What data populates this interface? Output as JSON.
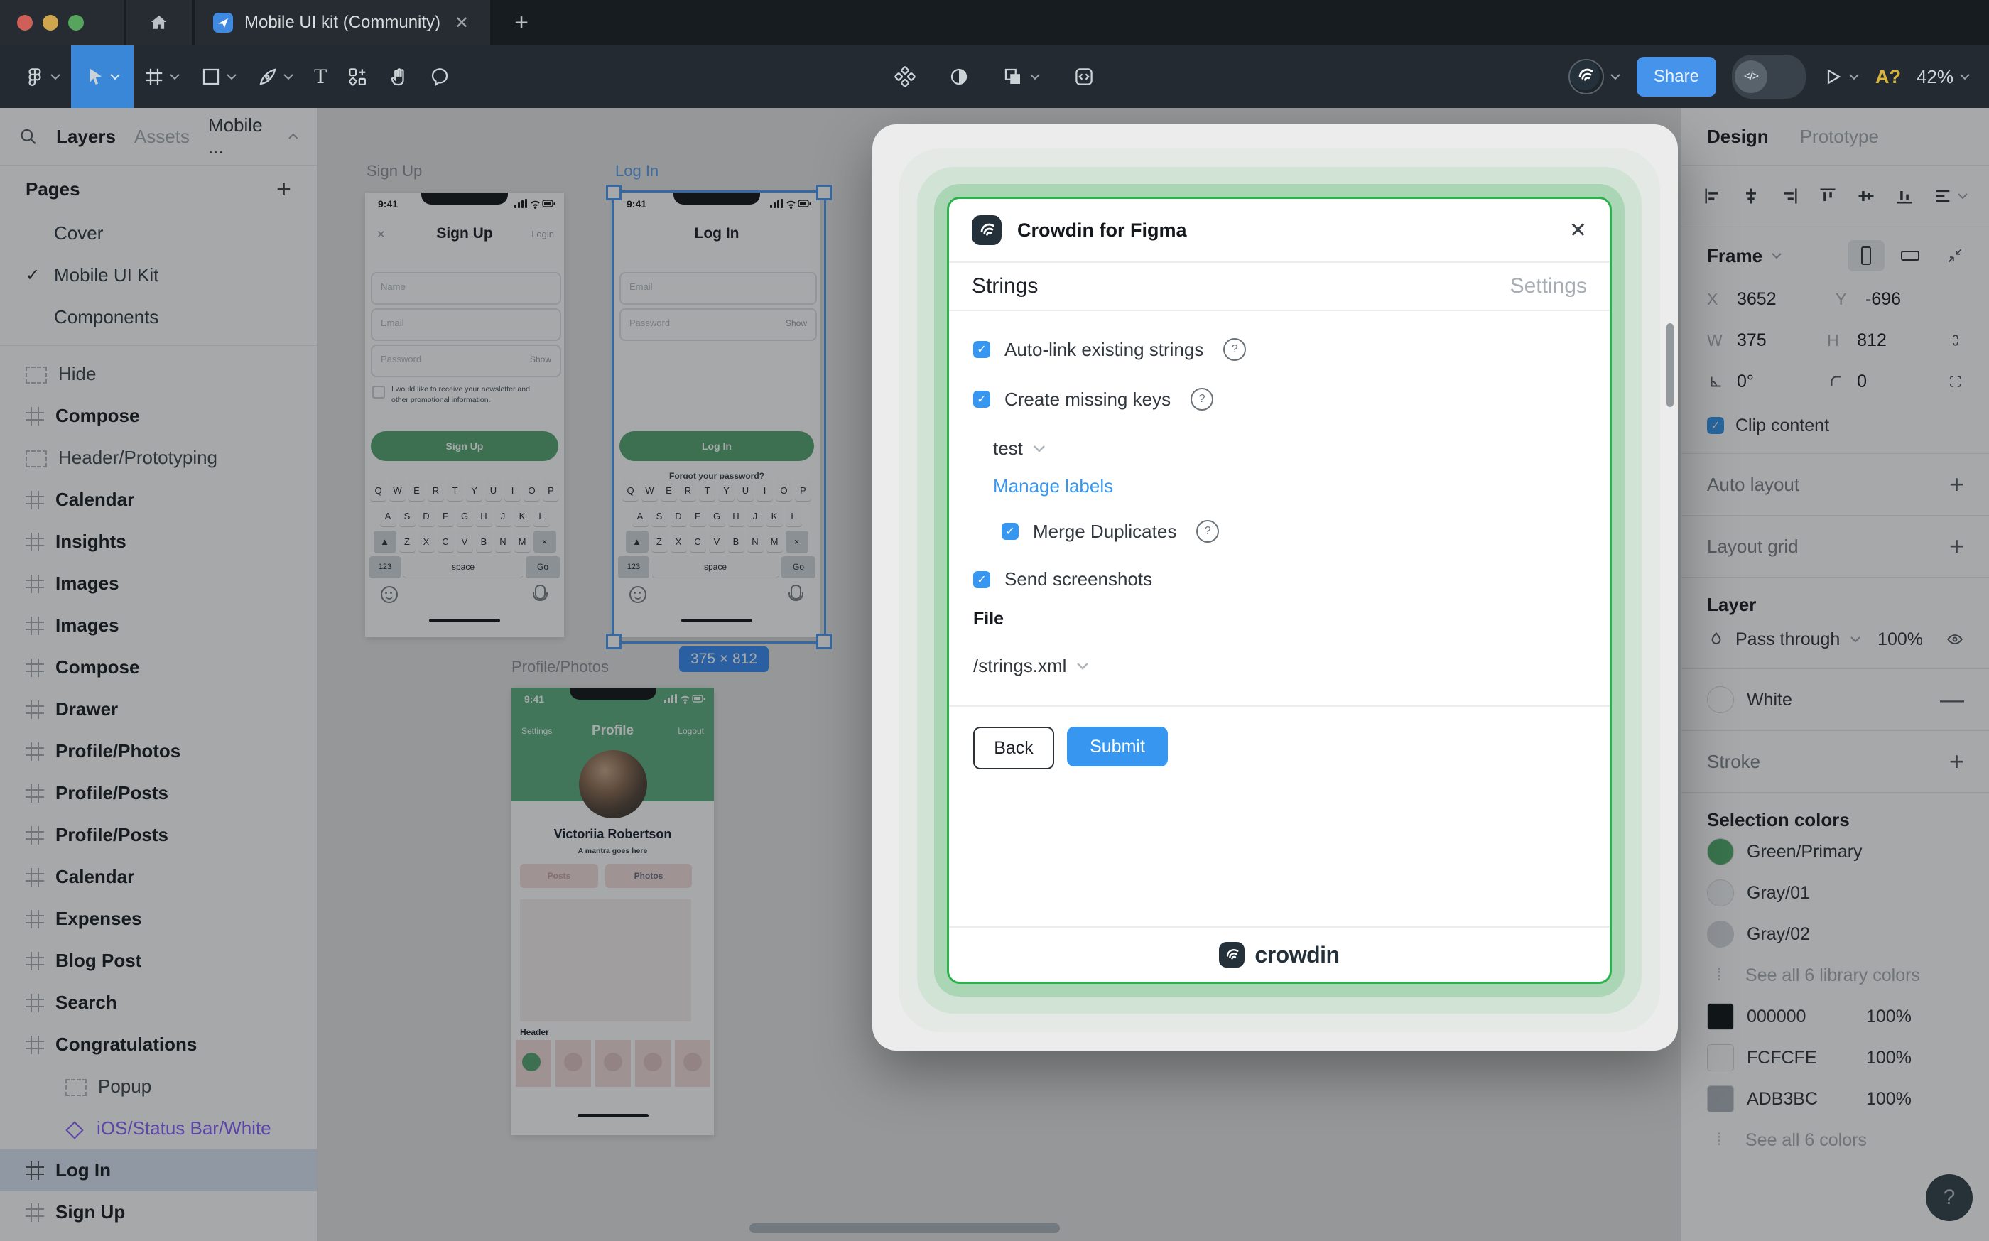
{
  "colors": {
    "accent_blue": "#3797f0",
    "figma_tool_blue": "#3a87d7",
    "share_blue": "#4693ec",
    "modal_border_green": "#2bb24c",
    "green_primary": "#57a773",
    "component_purple": "#8a63ff",
    "traffic_red": "#cf6059",
    "traffic_yellow": "#cfa64e",
    "traffic_green": "#57a45f"
  },
  "titlebar": {
    "tab_title": "Mobile UI kit (Community)",
    "close_glyph": "✕",
    "new_tab_glyph": "+"
  },
  "toolbar": {
    "share": "Share",
    "a_badge": "A?",
    "zoom": "42%",
    "dev_glyph": "</>"
  },
  "sidebar": {
    "tab_layers": "Layers",
    "tab_assets": "Assets",
    "page_menu": "Mobile ...",
    "pages_label": "Pages",
    "plus_glyph": "+",
    "check_glyph": "✓",
    "pages": [
      {
        "label": "Cover"
      },
      {
        "label": "Mobile UI Kit",
        "current": true
      },
      {
        "label": "Components"
      }
    ],
    "layers": [
      {
        "label": "Hide",
        "section": true
      },
      {
        "label": "Compose",
        "frame": true,
        "bold": true
      },
      {
        "label": "Header/Prototyping",
        "section": true
      },
      {
        "label": "Calendar",
        "frame": true,
        "bold": true
      },
      {
        "label": "Insights",
        "frame": true,
        "bold": true
      },
      {
        "label": "Images",
        "frame": true,
        "bold": true
      },
      {
        "label": "Images",
        "frame": true,
        "bold": true
      },
      {
        "label": "Compose",
        "frame": true,
        "bold": true
      },
      {
        "label": "Drawer",
        "frame": true,
        "bold": true
      },
      {
        "label": "Profile/Photos",
        "frame": true,
        "bold": true
      },
      {
        "label": "Profile/Posts",
        "frame": true,
        "bold": true
      },
      {
        "label": "Profile/Posts",
        "frame": true,
        "bold": true
      },
      {
        "label": "Calendar",
        "frame": true,
        "bold": true
      },
      {
        "label": "Expenses",
        "frame": true,
        "bold": true
      },
      {
        "label": "Blog Post",
        "frame": true,
        "bold": true
      },
      {
        "label": "Search",
        "frame": true,
        "bold": true
      },
      {
        "label": "Congratulations",
        "frame": true,
        "bold": true
      },
      {
        "label": "Popup",
        "section": true,
        "indent": true
      },
      {
        "label": "iOS/Status Bar/White",
        "instance": true,
        "indent": true,
        "purple": true
      },
      {
        "label": "Log In",
        "frame": true,
        "bold": true,
        "selected": true
      },
      {
        "label": "Sign Up",
        "frame": true,
        "bold": true
      }
    ]
  },
  "canvas": {
    "signup_label": "Sign Up",
    "login_label": "Log In",
    "profile_label": "Profile/Photos",
    "selection_badge": "375 × 812",
    "phone_time": "9:41",
    "signup": {
      "close": "✕",
      "title": "Sign Up",
      "login_link": "Login",
      "name_ph": "Name",
      "email_ph": "Email",
      "password_ph": "Password",
      "show": "Show",
      "newsletter": "I would like to receive your newsletter and other promotional information.",
      "button": "Sign Up"
    },
    "login": {
      "title": "Log In",
      "email_ph": "Email",
      "password_ph": "Password",
      "show": "Show",
      "button": "Log In",
      "forgot": "Forgot your password?"
    },
    "profile": {
      "nav_left": "Settings",
      "nav_title": "Profile",
      "nav_right": "Logout",
      "name": "Victoriia Robertson",
      "mantra": "A mantra goes here",
      "tab_posts": "Posts",
      "tab_photos": "Photos",
      "header_label": "Header"
    },
    "keyboard": {
      "row1": [
        "Q",
        "W",
        "E",
        "R",
        "T",
        "Y",
        "U",
        "I",
        "O",
        "P"
      ],
      "row2": [
        "A",
        "S",
        "D",
        "F",
        "G",
        "H",
        "J",
        "K",
        "L"
      ],
      "shift": "▲",
      "row3": [
        "Z",
        "X",
        "C",
        "V",
        "B",
        "N",
        "M"
      ],
      "backspace": "×",
      "num": "123",
      "space": "space",
      "go": "Go"
    }
  },
  "modal": {
    "app_title": "Crowdin for Figma",
    "close": "✕",
    "tab_strings": "Strings",
    "tab_settings": "Settings",
    "auto_link": "Auto-link existing strings",
    "create_keys": "Create missing keys",
    "label_value": "test",
    "manage_labels": "Manage labels",
    "merge_duplicates": "Merge Duplicates",
    "send_screenshots": "Send screenshots",
    "file_label": "File",
    "file_value": "/strings.xml",
    "back": "Back",
    "submit": "Submit",
    "brand": "crowdin",
    "check_glyph": "✓",
    "help_glyph": "?"
  },
  "right_panel": {
    "tab_design": "Design",
    "tab_prototype": "Prototype",
    "frame": {
      "label": "Frame",
      "x_label": "X",
      "x": "3652",
      "y_label": "Y",
      "y": "-696",
      "w_label": "W",
      "w": "375",
      "h_label": "H",
      "h": "812",
      "rotation": "0°",
      "radius": "0",
      "clip": "Clip content",
      "check_glyph": "✓"
    },
    "auto_layout": "Auto layout",
    "layout_grid": "Layout grid",
    "plus_glyph": "+",
    "minus_glyph": "—",
    "layer": {
      "label": "Layer",
      "blend": "Pass through",
      "opacity": "100%"
    },
    "fill": {
      "name": "White"
    },
    "stroke_label": "Stroke",
    "selection_colors": {
      "label": "Selection colors",
      "library": [
        {
          "name": "Green/Primary",
          "color": "#52ab6d"
        },
        {
          "name": "Gray/01",
          "color": "#f4f6f8"
        },
        {
          "name": "Gray/02",
          "color": "#d9dde2"
        }
      ],
      "see_library": "See all 6 library colors",
      "values": [
        {
          "hex": "000000",
          "opacity": "100%",
          "color": "#14181c"
        },
        {
          "hex": "FCFCFE",
          "opacity": "100%",
          "color": "#fcfcfe"
        },
        {
          "hex": "ADB3BC",
          "opacity": "100%",
          "color": "#adb3bc"
        }
      ],
      "see_all": "See all 6 colors",
      "dots_glyph": "⁞"
    },
    "help": "?"
  }
}
